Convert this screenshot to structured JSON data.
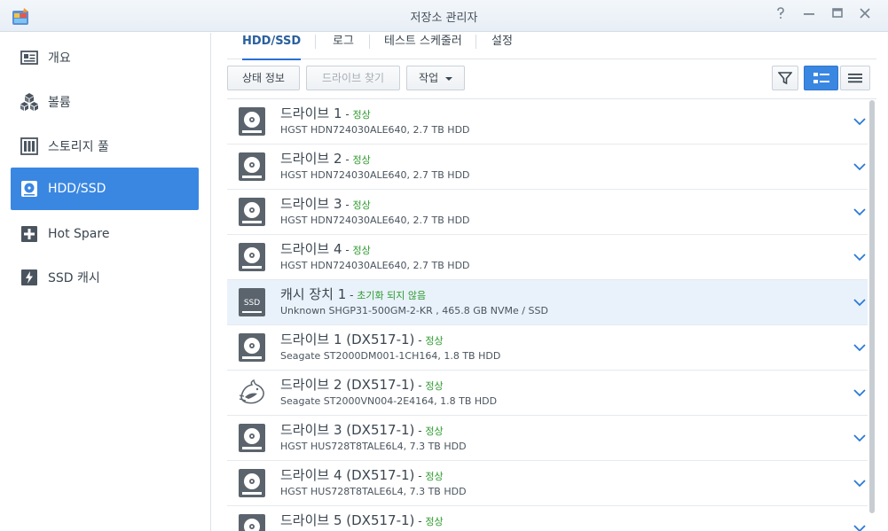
{
  "window": {
    "title": "저장소 관리자",
    "help_icon": "question-mark-icon",
    "minimize_icon": "minimize-icon",
    "maximize_icon": "maximize-icon",
    "close_icon": "close-icon"
  },
  "sidebar": {
    "items": [
      {
        "label": "개요",
        "icon": "overview-icon"
      },
      {
        "label": "볼륨",
        "icon": "volume-cubes-icon"
      },
      {
        "label": "스토리지 풀",
        "icon": "storage-pool-icon"
      },
      {
        "label": "HDD/SSD",
        "icon": "hdd-icon",
        "active": true
      },
      {
        "label": "Hot Spare",
        "icon": "hot-spare-plus-icon"
      },
      {
        "label": "SSD 캐시",
        "icon": "ssd-cache-lightning-icon"
      }
    ]
  },
  "tabs": [
    {
      "label": "HDD/SSD",
      "active": true
    },
    {
      "label": "로그"
    },
    {
      "label": "테스트 스케줄러"
    },
    {
      "label": "설정"
    }
  ],
  "toolbar": {
    "status_info": "상태 정보",
    "find_drive": "드라이브 찾기",
    "action": "작업",
    "filter_icon": "filter-icon",
    "detail_view_icon": "detail-view-icon",
    "list_view_icon": "list-view-icon"
  },
  "colors": {
    "accent": "#3a87e2",
    "status_ok": "#2e9a2e",
    "highlight_row": "#e9f2fb"
  },
  "drives": [
    {
      "name": "드라이브 1",
      "status": "정상",
      "desc": "HGST HDN724030ALE640, 2.7 TB HDD",
      "icon": "hdd-icon"
    },
    {
      "name": "드라이브 2",
      "status": "정상",
      "desc": "HGST HDN724030ALE640, 2.7 TB HDD",
      "icon": "hdd-icon"
    },
    {
      "name": "드라이브 3",
      "status": "정상",
      "desc": "HGST HDN724030ALE640, 2.7 TB HDD",
      "icon": "hdd-icon"
    },
    {
      "name": "드라이브 4",
      "status": "정상",
      "desc": "HGST HDN724030ALE640, 2.7 TB HDD",
      "icon": "hdd-icon"
    },
    {
      "name": "캐시 장치 1",
      "status": "초기화 되지 않음",
      "desc": "Unknown SHGP31-500GM-2-KR , 465.8 GB NVMe / SSD",
      "icon": "ssd-icon",
      "icon_text": "SSD",
      "highlighted": true
    },
    {
      "name": "드라이브 1 (DX517-1)",
      "status": "정상",
      "desc": "Seagate ST2000DM001-1CH164, 1.8 TB HDD",
      "icon": "hdd-icon"
    },
    {
      "name": "드라이브 2 (DX517-1)",
      "status": "정상",
      "desc": "Seagate ST2000VN004-2E4164, 1.8 TB HDD",
      "icon": "ironwolf-wolf-icon"
    },
    {
      "name": "드라이브 3 (DX517-1)",
      "status": "정상",
      "desc": "HGST HUS728T8TALE6L4, 7.3 TB HDD",
      "icon": "hdd-icon"
    },
    {
      "name": "드라이브 4 (DX517-1)",
      "status": "정상",
      "desc": "HGST HUS728T8TALE6L4, 7.3 TB HDD",
      "icon": "hdd-icon"
    },
    {
      "name": "드라이브 5 (DX517-1)",
      "status": "정상",
      "desc": "",
      "icon": "hdd-icon"
    }
  ],
  "separator": " - "
}
